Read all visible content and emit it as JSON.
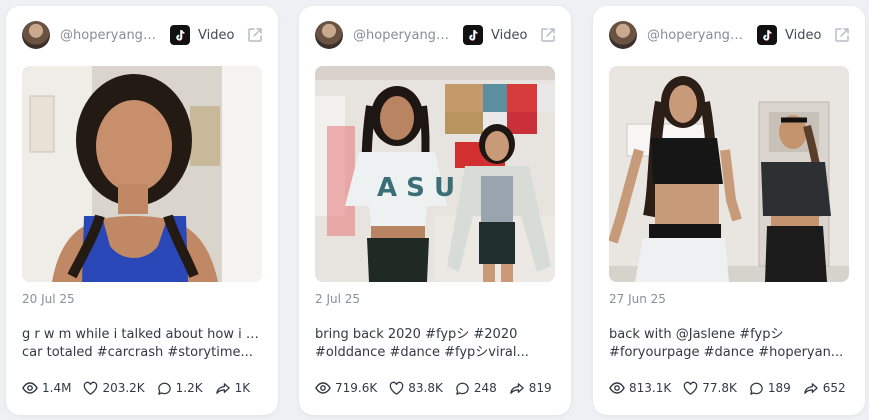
{
  "posts": [
    {
      "handle": "@hoperyangr...",
      "platform": "Video",
      "date": "20 Jul 25",
      "caption": [
        "g r w m while i talked about how i got my",
        "car totaled #carcrash #storytime..."
      ],
      "views": "1.4M",
      "likes": "203.2K",
      "comments": "1.2K",
      "shares": "1K"
    },
    {
      "handle": "@hoperyangr...",
      "platform": "Video",
      "date": "2 Jul 25",
      "caption": [
        "bring back 2020 #fypシ #2020",
        "#olddance #dance #fypシviral..."
      ],
      "views": "719.6K",
      "likes": "83.8K",
      "comments": "248",
      "shares": "819"
    },
    {
      "handle": "@hoperyangr...",
      "platform": "Video",
      "date": "27 Jun 25",
      "caption": [
        "back with @Jaslene #fypシ",
        "#foryourpage #dance #hoperyan..."
      ],
      "views": "813.1K",
      "likes": "77.8K",
      "comments": "189",
      "shares": "652"
    }
  ],
  "icons": {
    "platform": "tiktok-icon",
    "open": "external-link-icon",
    "views": "eye-icon",
    "likes": "heart-icon",
    "comments": "comment-icon",
    "shares": "share-icon"
  }
}
